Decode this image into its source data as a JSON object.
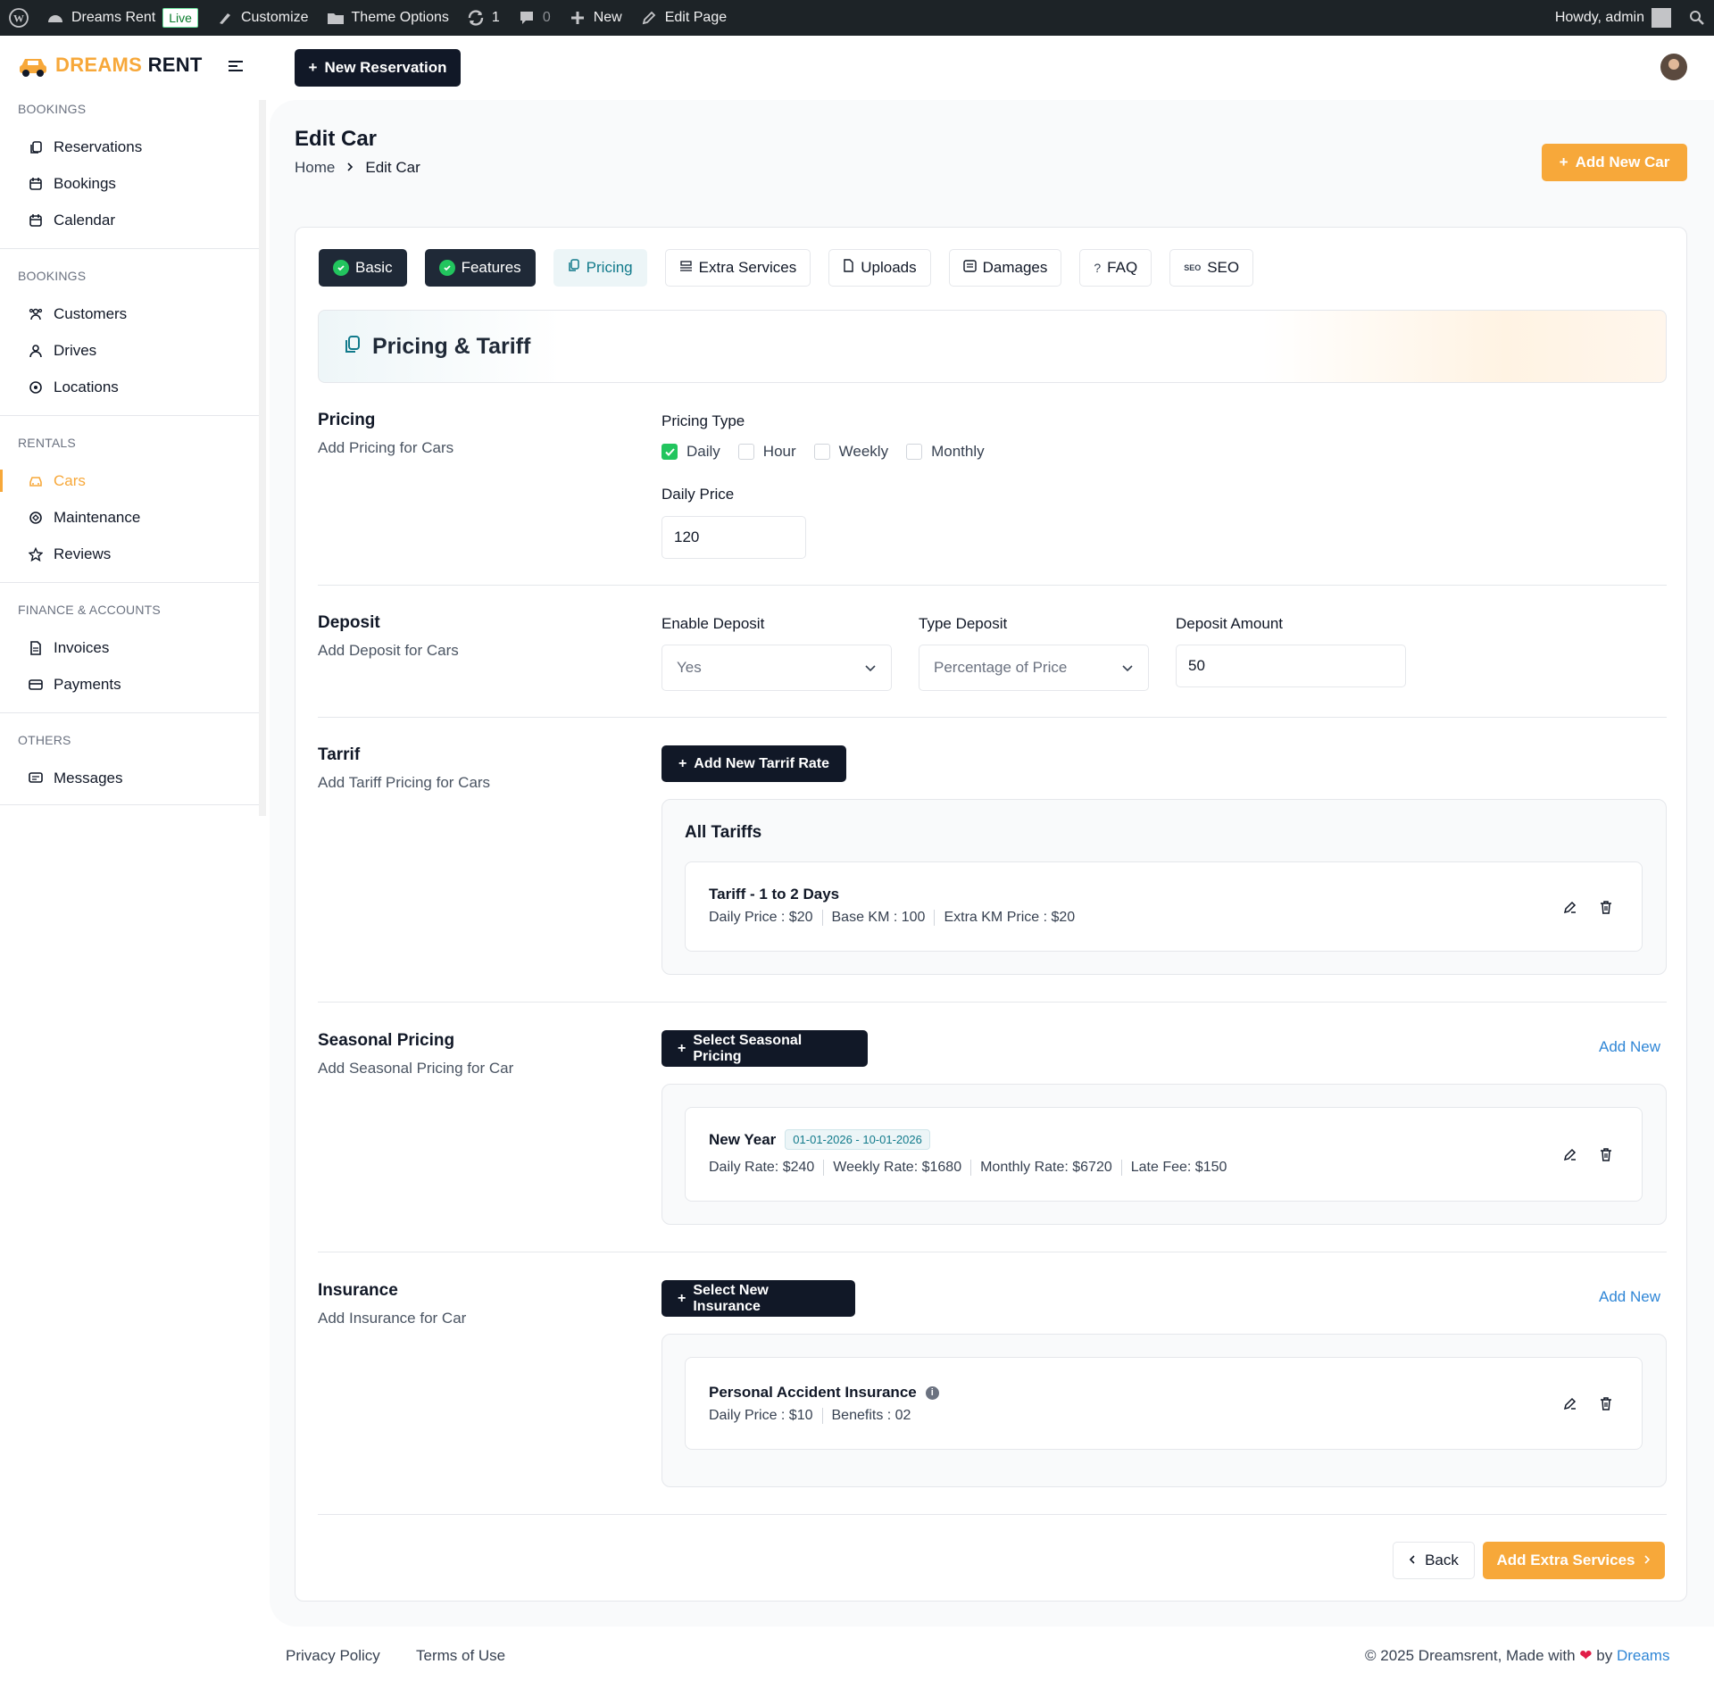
{
  "adminbar": {
    "site_name": "Dreams Rent",
    "live_badge": "Live",
    "customize": "Customize",
    "theme_options": "Theme Options",
    "updates_count": "1",
    "comments_count": "0",
    "new": "New",
    "edit_page": "Edit Page",
    "howdy": "Howdy, admin"
  },
  "brand": {
    "part1": "DREAMS",
    "part2": "RENT",
    "accent": "#f7a83a"
  },
  "header": {
    "new_reservation": "New Reservation"
  },
  "sidebar": {
    "sections": [
      {
        "title": "BOOKINGS",
        "items": [
          "Reservations",
          "Bookings",
          "Calendar"
        ]
      },
      {
        "title": "BOOKINGS",
        "items": [
          "Customers",
          "Drives",
          "Locations"
        ]
      },
      {
        "title": "RENTALS",
        "items": [
          "Cars",
          "Maintenance",
          "Reviews"
        ]
      },
      {
        "title": "FINANCE & ACCOUNTS",
        "items": [
          "Invoices",
          "Payments"
        ]
      },
      {
        "title": "OTHERS",
        "items": [
          "Messages"
        ]
      }
    ],
    "active_item": "Cars"
  },
  "page": {
    "title": "Edit Car",
    "breadcrumb_home": "Home",
    "breadcrumb_current": "Edit Car",
    "add_new_car": "Add New Car"
  },
  "tabs": [
    "Basic",
    "Features",
    "Pricing",
    "Extra Services",
    "Uploads",
    "Damages",
    "FAQ",
    "SEO"
  ],
  "section_title": "Pricing & Tariff",
  "pricing": {
    "heading": "Pricing",
    "sub": "Add Pricing for Cars",
    "type_label": "Pricing Type",
    "options": [
      "Daily",
      "Hour",
      "Weekly",
      "Monthly"
    ],
    "checked": "Daily",
    "daily_price_label": "Daily Price",
    "daily_price_value": "120"
  },
  "deposit": {
    "heading": "Deposit",
    "sub": "Add Deposit for Cars",
    "enable_label": "Enable Deposit",
    "enable_value": "Yes",
    "type_label": "Type Deposit",
    "type_value": "Percentage of Price",
    "amount_label": "Deposit Amount",
    "amount_value": "50"
  },
  "tariff": {
    "heading": "Tarrif",
    "sub": "Add Tariff Pricing for Cars",
    "add_button": "Add New Tarrif Rate",
    "all_title": "All Tariffs",
    "item_title": "Tariff - 1 to 2 Days",
    "daily": "Daily Price : $20",
    "base_km": "Base KM : 100",
    "extra_km": "Extra KM Price : $20"
  },
  "seasonal": {
    "heading": "Seasonal Pricing",
    "sub": "Add Seasonal Pricing for Car",
    "select_button": "Select Seasonal Pricing",
    "add_new": "Add New",
    "item_title": "New Year",
    "date_range": "01-01-2026 - 10-01-2026",
    "daily": "Daily Rate: $240",
    "weekly": "Weekly Rate: $1680",
    "monthly": "Monthly Rate: $6720",
    "late": "Late Fee: $150"
  },
  "insurance": {
    "heading": "Insurance",
    "sub": "Add Insurance for Car",
    "select_button": "Select New Insurance",
    "add_new": "Add New",
    "item_title": "Personal Accident Insurance",
    "daily": "Daily Price : $10",
    "benefits": "Benefits : 02"
  },
  "nav": {
    "back": "Back",
    "next": "Add Extra Services"
  },
  "footer": {
    "privacy": "Privacy Policy",
    "terms": "Terms of Use",
    "copyright": "© 2025 Dreamsrent, Made with",
    "by": "by",
    "brand_link": "Dreams"
  }
}
